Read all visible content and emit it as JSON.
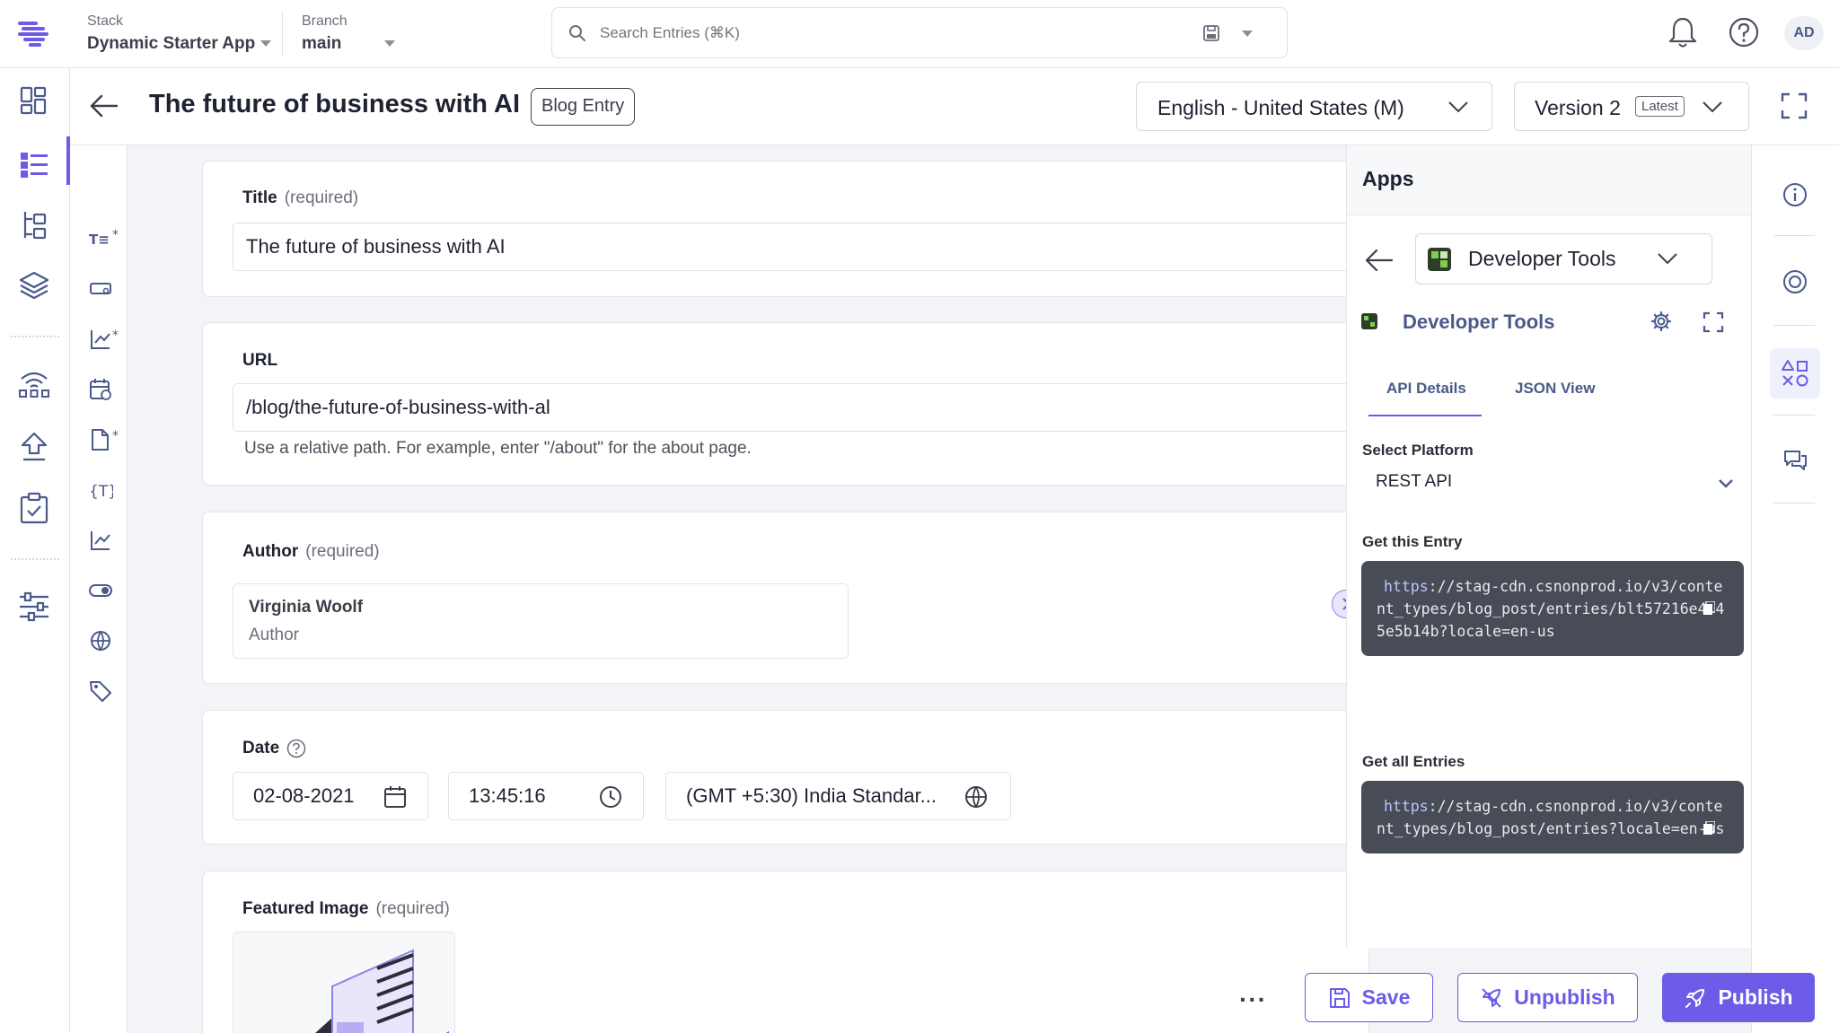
{
  "topbar": {
    "stack_label": "Stack",
    "stack_name": "Dynamic Starter App",
    "branch_label": "Branch",
    "branch_name": "main",
    "search_placeholder": "Search Entries (⌘K)",
    "avatar_initials": "AD"
  },
  "header": {
    "title": "The future of business with AI",
    "content_type_badge": "Blog Entry",
    "locale": "English - United States (M)",
    "version": "Version 2",
    "version_tag": "Latest"
  },
  "fields": {
    "title": {
      "label": "Title",
      "required": "(required)",
      "value": "The future of business with AI"
    },
    "url": {
      "label": "URL",
      "value": "/blog/the-future-of-business-with-al",
      "hint": "Use a relative path. For example, enter \"/about\" for the about page."
    },
    "author": {
      "label": "Author",
      "required": "(required)",
      "name": "Virginia Woolf",
      "type": "Author"
    },
    "date": {
      "label": "Date",
      "date": "02-08-2021",
      "time": "13:45:16",
      "timezone": "(GMT +5:30) India Standar..."
    },
    "featured_image": {
      "label": "Featured Image",
      "required": "(required)"
    }
  },
  "apps_panel": {
    "title": "Apps",
    "selected_app": "Developer Tools",
    "app_title": "Developer Tools",
    "tabs": [
      {
        "label": "API Details",
        "active": true
      },
      {
        "label": "JSON View",
        "active": false
      }
    ],
    "platform_label": "Select Platform",
    "platform_value": "REST API",
    "get_entry_label": "Get this Entry",
    "get_entry_scheme": "https",
    "get_entry_rest": "://stag-cdn.csnonprod.io/v3/content_types/blog_post/entries/blt57216e4 4 5e5b14b?locale=en-us",
    "get_all_label": "Get all Entries",
    "get_all_scheme": "https",
    "get_all_rest": "://stag-cdn.csnonprod.io/v3/content_types/blog_post/entries?locale=en-us"
  },
  "actions": {
    "more": "···",
    "save": "Save",
    "unpublish": "Unpublish",
    "publish": "Publish"
  },
  "colors": {
    "accent": "#6c5ce7",
    "code_bg": "#474c57",
    "brand_link": "#4a5a8a"
  }
}
